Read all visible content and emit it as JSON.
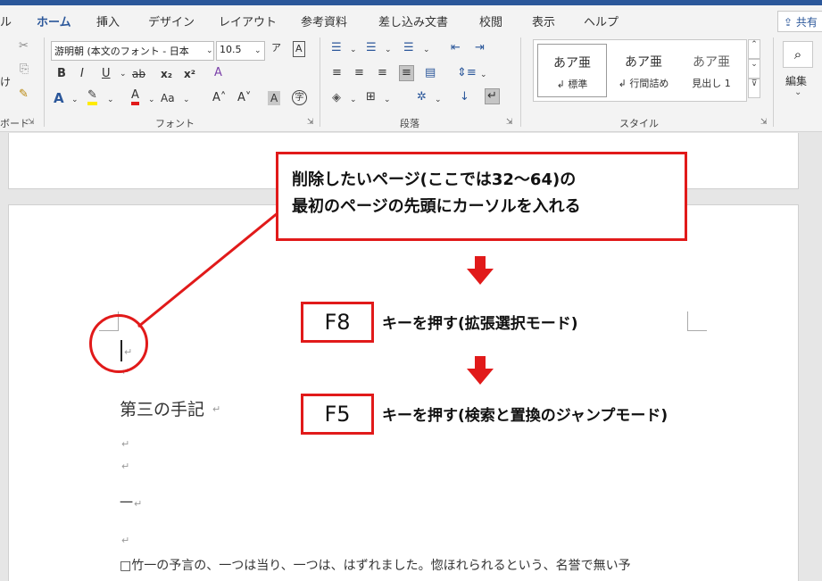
{
  "ribbon": {
    "tabs": [
      "ル",
      "ホーム",
      "挿入",
      "デザイン",
      "レイアウト",
      "参考資料",
      "差し込み文書",
      "校閲",
      "表示",
      "ヘルプ"
    ],
    "active_tab": "ホーム",
    "share_label": "共有",
    "clipboard": {
      "paste_label": "け",
      "group_label": "ボード"
    },
    "font": {
      "font_name": "游明朝 (本文のフォント - 日本",
      "font_size": "10.5",
      "group_label": "フォント"
    },
    "paragraph": {
      "group_label": "段落"
    },
    "styles": {
      "group_label": "スタイル",
      "items": [
        {
          "preview": "あア亜",
          "name": "↲ 標準"
        },
        {
          "preview": "あア亜",
          "name": "↲ 行間詰め"
        },
        {
          "preview": "あア亜",
          "name": "見出し 1"
        }
      ]
    },
    "editing": {
      "label": "編集"
    }
  },
  "document": {
    "heading": "第三の手記",
    "dash_line": "一",
    "body_line": "□竹一の予言の、一つは当り、一つは、はずれました。惚ほれられるという、名誉で無い予",
    "para_mark": "↵"
  },
  "annotations": {
    "callout_lines": [
      "削除したいページ(ここでは32〜64)の",
      "最初のページの先頭にカーソルを入れる"
    ],
    "step1_key": "F8",
    "step1_text": "キーを押す(拡張選択モード)",
    "step2_key": "F5",
    "step2_text": "キーを押す(検索と置換のジャンプモード)"
  },
  "colors": {
    "accent": "#2b579a",
    "annotation": "#e11a1a"
  }
}
